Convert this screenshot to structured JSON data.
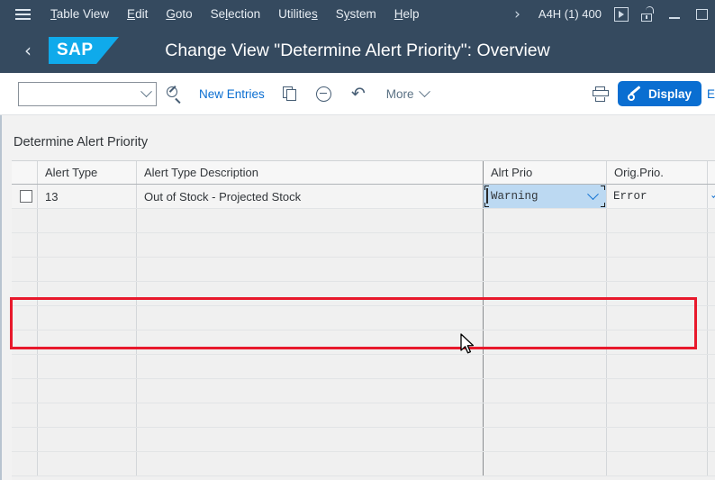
{
  "menubar": {
    "hamburger_icon": "hamburger-menu-icon",
    "items": [
      {
        "label": "Table View",
        "accesskey": "T"
      },
      {
        "label": "Edit",
        "accesskey": "E"
      },
      {
        "label": "Goto",
        "accesskey": "G"
      },
      {
        "label": "Selection",
        "accesskey": "l"
      },
      {
        "label": "Utilities",
        "accesskey": "s"
      },
      {
        "label": "System",
        "accesskey": "y"
      },
      {
        "label": "Help",
        "accesskey": "H"
      }
    ],
    "overflow_icon": "chevron-right-icon",
    "system_info": "A4H (1) 400",
    "execute_icon": "execute-box-icon",
    "lock_icon": "unlocked-padlock-icon",
    "minimize_icon": "minimize-icon",
    "maximize_icon": "maximize-icon"
  },
  "header": {
    "back_icon": "back-chevron-icon",
    "logo_text": "SAP",
    "title": "Change View \"Determine Alert Priority\": Overview"
  },
  "toolbar": {
    "view_select_value": "",
    "view_select_placeholder": "",
    "search_icon": "magnifier-icon",
    "new_entries_label": "New Entries",
    "copy_icon": "copy-entry-icon",
    "delete_icon": "delete-minus-icon",
    "undo_icon": "undo-arrow-icon",
    "more_label": "More",
    "more_chevron_icon": "chevron-down-icon",
    "print_icon": "printer-icon",
    "display_label": "Display",
    "display_icon": "edit-pencil-icon",
    "display_bg_color": "#0a6ed1",
    "edit_partial_label": "E"
  },
  "content": {
    "section_title": "Determine Alert Priority",
    "columns": [
      {
        "key": "select",
        "label": ""
      },
      {
        "key": "alert_type",
        "label": "Alert Type"
      },
      {
        "key": "alert_type_description",
        "label": "Alert Type Description"
      },
      {
        "key": "alrt_prio",
        "label": "Alrt  Prio"
      },
      {
        "key": "orig_prio",
        "label": "Orig.Prio."
      },
      {
        "key": "extra",
        "label": ""
      }
    ],
    "rows": [
      {
        "selected": false,
        "alert_type": "13",
        "alert_type_description": "Out of Stock - Projected Stock",
        "alrt_prio": "Warning",
        "orig_prio": "Error",
        "alrt_prio_focused": true
      }
    ],
    "empty_row_count": 11,
    "highlight_color": "#e8192c"
  }
}
